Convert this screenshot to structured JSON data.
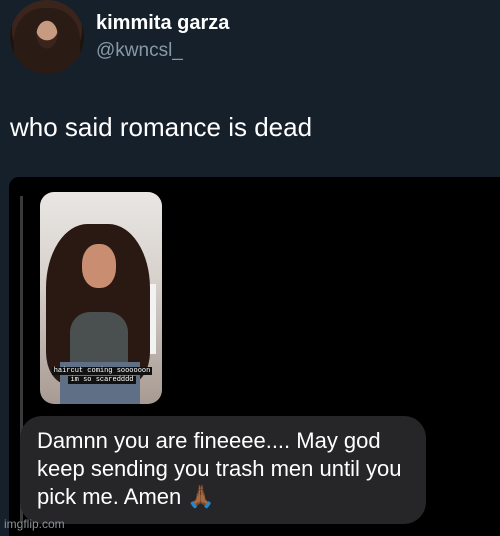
{
  "tweet": {
    "display_name": "kimmita garza",
    "handle": "@kwncsl_",
    "text": "who said romance is dead"
  },
  "story_reply": {
    "caption_line1": "haircut coming soooooon",
    "caption_line2": "im so scaredddd",
    "message": "Damnn you are fineeee.... May god keep sending you trash men until you pick me. Amen 🙏🏾"
  },
  "watermark": "imgflip.com",
  "colors": {
    "background": "#15202b",
    "handle": "#8899a6",
    "media_background": "#000000",
    "bubble": "#262629"
  }
}
